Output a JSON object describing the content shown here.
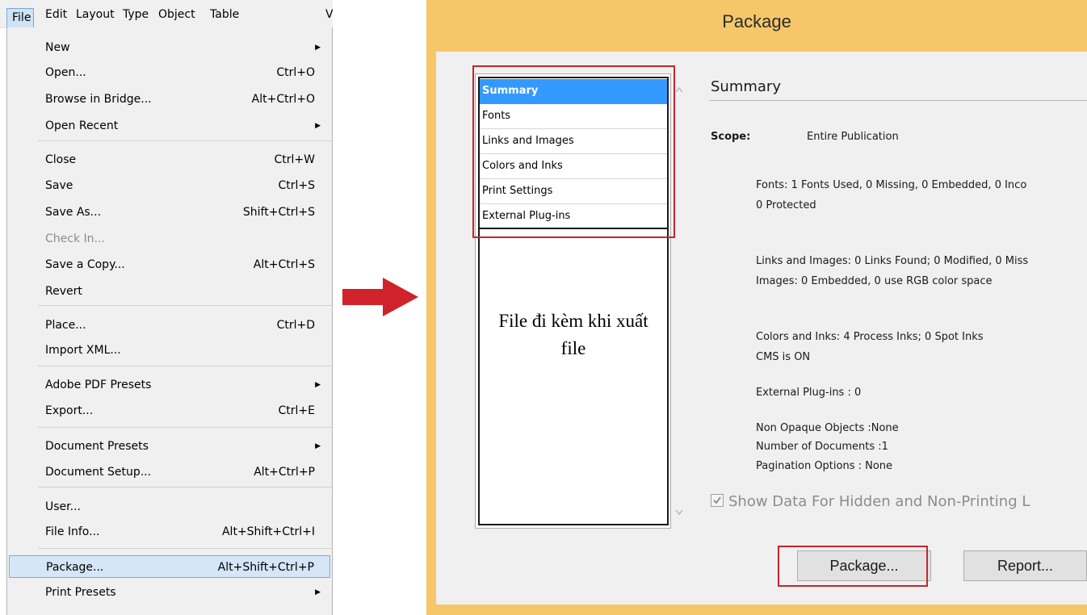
{
  "menubar": {
    "items": [
      "File",
      "Edit",
      "Layout",
      "Type",
      "Object",
      "Table",
      "V"
    ]
  },
  "file_menu": {
    "items": [
      {
        "label": "New",
        "shortcut": "",
        "submenu": true
      },
      {
        "label": "Open...",
        "shortcut": "Ctrl+O"
      },
      {
        "label": "Browse in Bridge...",
        "shortcut": "Alt+Ctrl+O"
      },
      {
        "label": "Open Recent",
        "shortcut": "",
        "submenu": true
      },
      {
        "label": "Close",
        "shortcut": "Ctrl+W"
      },
      {
        "label": "Save",
        "shortcut": "Ctrl+S"
      },
      {
        "label": "Save As...",
        "shortcut": "Shift+Ctrl+S"
      },
      {
        "label": "Check In...",
        "shortcut": "",
        "disabled": true
      },
      {
        "label": "Save a Copy...",
        "shortcut": "Alt+Ctrl+S"
      },
      {
        "label": "Revert",
        "shortcut": ""
      },
      {
        "label": "Place...",
        "shortcut": "Ctrl+D"
      },
      {
        "label": "Import XML...",
        "shortcut": ""
      },
      {
        "label": "Adobe PDF Presets",
        "shortcut": "",
        "submenu": true
      },
      {
        "label": "Export...",
        "shortcut": "Ctrl+E"
      },
      {
        "label": "Document Presets",
        "shortcut": "",
        "submenu": true
      },
      {
        "label": "Document Setup...",
        "shortcut": "Alt+Ctrl+P"
      },
      {
        "label": "User...",
        "shortcut": ""
      },
      {
        "label": "File Info...",
        "shortcut": "Alt+Shift+Ctrl+I"
      },
      {
        "label": "Package...",
        "shortcut": "Alt+Shift+Ctrl+P",
        "highlighted": true
      },
      {
        "label": "Print Presets",
        "shortcut": "",
        "submenu": true
      }
    ]
  },
  "dialog": {
    "title": "Package",
    "sections": [
      "Summary",
      "Fonts",
      "Links and Images",
      "Colors and Inks",
      "Print Settings",
      "External Plug-ins"
    ],
    "selected_section": "Summary",
    "annotation": "File đi kèm khi xuất file",
    "summary": {
      "heading": "Summary",
      "scope_label": "Scope:",
      "scope_value": "Entire Publication",
      "fonts_line1": "Fonts: 1 Fonts Used, 0 Missing, 0 Embedded, 0 Inco",
      "fonts_line2": "0 Protected",
      "links_line1": "Links and Images: 0 Links Found; 0 Modified, 0 Miss",
      "links_line2": "Images: 0 Embedded, 0 use RGB color space",
      "colors_line1": "Colors and Inks: 4 Process Inks; 0 Spot Inks",
      "colors_line2": "CMS is ON",
      "plugins_line": "External Plug-ins : 0",
      "nonopaque_line": "Non Opaque Objects :None",
      "documents_line": "Number of Documents :1",
      "pagination_line": "Pagination Options : None"
    },
    "checkbox_label": "Show Data For Hidden and Non-Printing L",
    "checkbox_checked": true,
    "package_button": "Package...",
    "report_button": "Report..."
  },
  "colors": {
    "dialog_frame": "#f5c769",
    "selection_blue": "#3399ff",
    "annotation_red": "#c8242b",
    "arrow_red": "#d0222a"
  }
}
